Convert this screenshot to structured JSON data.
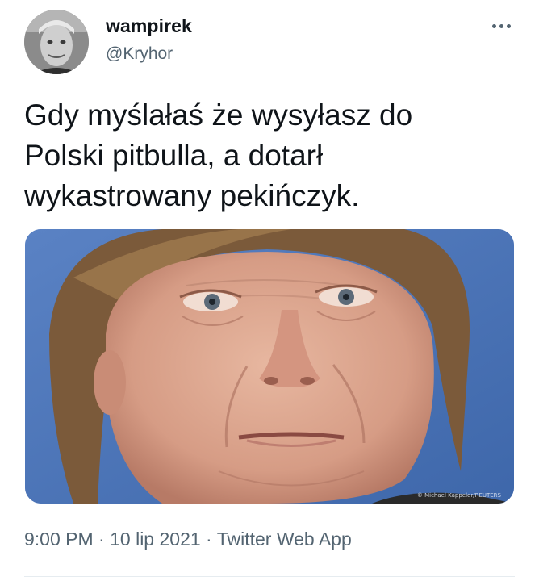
{
  "user": {
    "display_name": "wampirek",
    "handle": "@Kryhor"
  },
  "icons": {
    "more": "more-options-icon"
  },
  "tweet": {
    "text": "Gdy myślałaś że wysyłasz do\nPolski pitbulla, a dotarł\nwykastrowany pekińczyk.",
    "media_credit": "© Michael Kappeler/REUTERS"
  },
  "meta": {
    "time": "9:00 PM",
    "separator": "·",
    "date": "10 lip 2021",
    "source": "Twitter Web App"
  },
  "colors": {
    "text_primary": "#0f1419",
    "text_secondary": "#536471",
    "media_background": "#4a74b8"
  }
}
